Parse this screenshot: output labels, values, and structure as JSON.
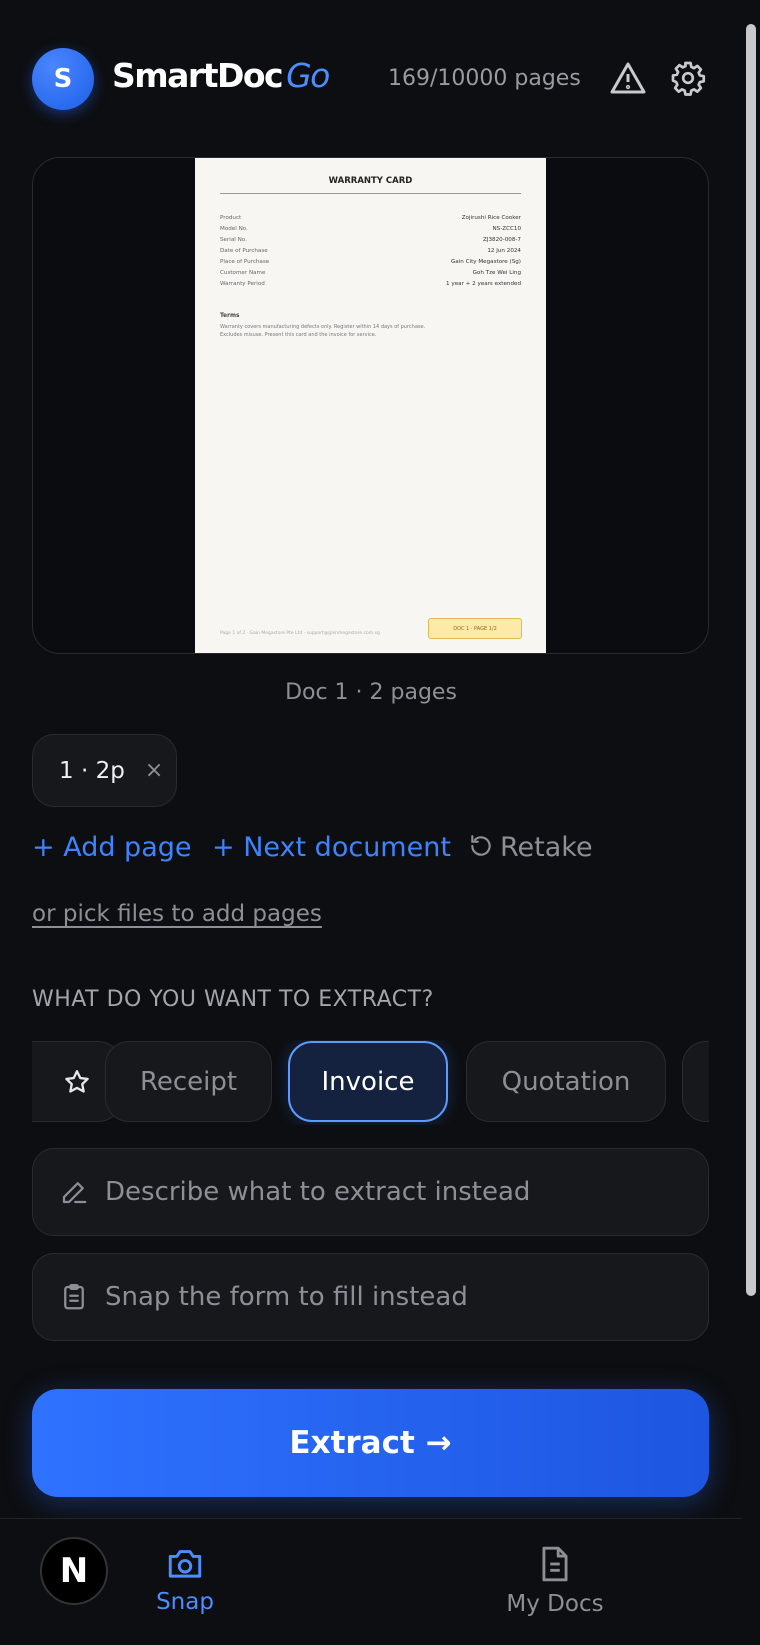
{
  "header": {
    "avatar_initial": "S",
    "brand_main": "SmartDoc",
    "brand_accent": "Go",
    "quota": "169/10000 pages"
  },
  "preview": {
    "document_title": "WARRANTY CARD",
    "rows": [
      {
        "label": "Product",
        "value": "Zojirushi Rice Cooker"
      },
      {
        "label": "Model No.",
        "value": "NS-ZCC10"
      },
      {
        "label": "Serial No.",
        "value": "ZJ3820-008-7"
      },
      {
        "label": "Date of Purchase",
        "value": "12 Jun 2024"
      },
      {
        "label": "Place of Purchase",
        "value": "Gain City Megastore (Sg)"
      },
      {
        "label": "Customer Name",
        "value": "Goh Tze Wei Ling"
      },
      {
        "label": "Warranty Period",
        "value": "1 year + 2 years extended"
      }
    ],
    "terms_heading": "Terms",
    "terms_text": "Warranty covers manufacturing defects only. Register within 14 days of purchase. Excludes misuse. Present this card and the invoice for service.",
    "footer_text": "Page 1 of 2 · Gain Megastore Pte Ltd · support@gainmegastore.com.sg",
    "stamp_text": "DOC 1 · PAGE 1/2"
  },
  "caption": "Doc 1 · 2 pages",
  "chip": {
    "label": "1 · 2p",
    "remove": "×"
  },
  "actions": {
    "add_page": "+ Add page",
    "next_document": "+ Next document",
    "retake": "Retake",
    "pick_files": "or pick files to add pages"
  },
  "section_title": "WHAT DO YOU WANT TO EXTRACT?",
  "doc_types": [
    {
      "label": "Receipt"
    },
    {
      "label": "Invoice",
      "selected": true
    },
    {
      "label": "Quotation"
    }
  ],
  "fields": {
    "describe_placeholder": "Describe what to extract instead",
    "snap_form_placeholder": "Snap the form to fill instead"
  },
  "extract_button": "Extract →",
  "nav": {
    "badge": "N",
    "snap": "Snap",
    "my_docs": "My Docs"
  },
  "colors": {
    "accent": "#3d84ff",
    "background": "#0d0e11"
  }
}
